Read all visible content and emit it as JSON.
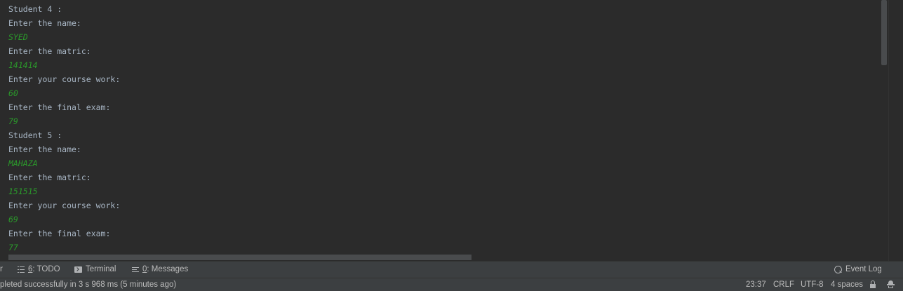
{
  "console": {
    "lines": [
      {
        "text": "Student 4 :",
        "kind": "output"
      },
      {
        "text": "Enter the name:",
        "kind": "output"
      },
      {
        "text": "SYED",
        "kind": "input"
      },
      {
        "text": "Enter the matric:",
        "kind": "output"
      },
      {
        "text": "141414",
        "kind": "input"
      },
      {
        "text": "Enter your course work:",
        "kind": "output"
      },
      {
        "text": "60",
        "kind": "input"
      },
      {
        "text": "Enter the final exam:",
        "kind": "output"
      },
      {
        "text": "79",
        "kind": "input"
      },
      {
        "text": "Student 5 :",
        "kind": "output"
      },
      {
        "text": "Enter the name:",
        "kind": "output"
      },
      {
        "text": "MAHAZA",
        "kind": "input"
      },
      {
        "text": "Enter the matric:",
        "kind": "output"
      },
      {
        "text": "151515",
        "kind": "input"
      },
      {
        "text": "Enter your course work:",
        "kind": "output"
      },
      {
        "text": "69",
        "kind": "input"
      },
      {
        "text": "Enter the final exam:",
        "kind": "input_prompt_placeholder_unused"
      },
      {
        "text": "77",
        "kind": "input"
      }
    ]
  },
  "toolwindow_bar": {
    "edge_label": "n",
    "todo": {
      "number": "6",
      "label": ": TODO",
      "icon": "todo-list-icon"
    },
    "terminal": {
      "label": "Terminal",
      "icon": "terminal-icon"
    },
    "messages": {
      "number": "0",
      "label": ": Messages",
      "icon": "messages-icon"
    },
    "event_log": {
      "label": "Event Log",
      "icon": "event-log-icon"
    }
  },
  "status_bar": {
    "message": "pleted successfully in 3 s 968 ms (5 minutes ago)",
    "caret_position": "23:37",
    "line_separator": "CRLF",
    "encoding": "UTF-8",
    "indent": "4 spaces",
    "lock_icon": "unlock-icon",
    "inspector_icon": "hector-inspector-icon"
  },
  "colors": {
    "background": "#2b2b2b",
    "output_text": "#a9b7c6",
    "input_text": "#2b9a2b",
    "toolbar_bg": "#3c3f41",
    "toolbar_text": "#bbbbbb"
  }
}
